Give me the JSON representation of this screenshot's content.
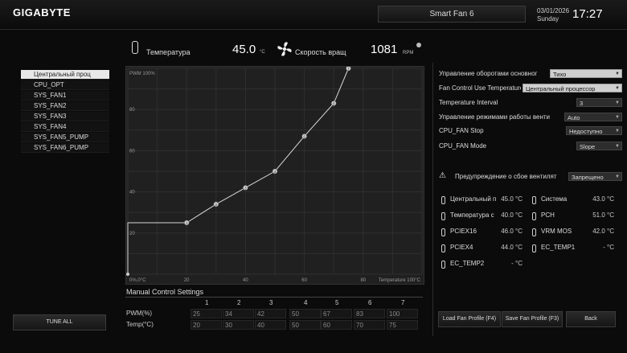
{
  "header": {
    "brand": "GIGABYTE",
    "title": "Smart Fan 6",
    "date": "03/01/2026",
    "day": "Sunday",
    "time": "17:27"
  },
  "stats": {
    "temp_label": "Температура",
    "temp_value": "45.0",
    "temp_unit": "°C",
    "speed_label": "Скорость вращ",
    "speed_value": "1081",
    "speed_unit": "RPM"
  },
  "fans": [
    "Центральный проц",
    "CPU_OPT",
    "SYS_FAN1",
    "SYS_FAN2",
    "SYS_FAN3",
    "SYS_FAN4",
    "SYS_FAN5_PUMP",
    "SYS_FAN6_PUMP"
  ],
  "tune_all": "TUNE ALL",
  "graph": {
    "y_title": "PWM 100%",
    "x_title": "Temperature 100°C",
    "origin": "0%,0°C",
    "y_ticks": [
      "80",
      "60",
      "40",
      "20"
    ],
    "x_ticks": [
      "20",
      "40",
      "60",
      "80"
    ]
  },
  "chart_data": {
    "type": "line",
    "xlabel": "Temperature 100°C",
    "ylabel": "PWM 100%",
    "xlim": [
      0,
      100
    ],
    "ylim": [
      0,
      100
    ],
    "points": [
      {
        "x": 20,
        "y": 25
      },
      {
        "x": 30,
        "y": 34
      },
      {
        "x": 40,
        "y": 42
      },
      {
        "x": 50,
        "y": 50
      },
      {
        "x": 60,
        "y": 67
      },
      {
        "x": 70,
        "y": 83
      },
      {
        "x": 75,
        "y": 100
      }
    ],
    "lead_in": {
      "x": 0,
      "y": 25
    }
  },
  "manual": {
    "title": "Manual Control Settings",
    "cols": [
      "1",
      "2",
      "3",
      "4",
      "5",
      "6",
      "7"
    ],
    "pwm_label": "PWM(%)",
    "temp_label": "Temp(°C)",
    "pwm": [
      "25",
      "34",
      "42",
      "50",
      "67",
      "83",
      "100"
    ],
    "temp": [
      "20",
      "30",
      "40",
      "50",
      "60",
      "70",
      "75"
    ]
  },
  "settings": [
    {
      "label": "Управление оборотами основног",
      "value": "Тихо"
    },
    {
      "label": "Fan Control Use Temperature Input",
      "value": "Центральный процессор"
    },
    {
      "label": "Temperature Interval",
      "value": "3"
    },
    {
      "label": "Управление режимами работы венти",
      "value": "Auto"
    },
    {
      "label": "CPU_FAN Stop",
      "value": "Недоступно"
    },
    {
      "label": "CPU_FAN Mode",
      "value": "Slope"
    }
  ],
  "warning": {
    "label": "Предупреждение о сбое вентилят",
    "value": "Запрещено"
  },
  "temps": [
    {
      "label": "Центральный п",
      "value": "45.0 °C"
    },
    {
      "label": "Система",
      "value": "43.0 °C"
    },
    {
      "label": "Температура с",
      "value": "40.0 °C"
    },
    {
      "label": "PCH",
      "value": "51.0 °C"
    },
    {
      "label": "PCIEX16",
      "value": "46.0 °C"
    },
    {
      "label": "VRM MOS",
      "value": "42.0 °C"
    },
    {
      "label": "PCIEX4",
      "value": "44.0 °C"
    },
    {
      "label": "EC_TEMP1",
      "value": "- °C"
    },
    {
      "label": "EC_TEMP2",
      "value": "- °C"
    }
  ],
  "buttons": {
    "load": "Load Fan Profile (F4)",
    "save": "Save Fan Profile (F3)",
    "back": "Back"
  },
  "colors": {
    "bg": "#0b0b0b",
    "graph_bg": "#202020",
    "curve": "#d8d8d8"
  }
}
